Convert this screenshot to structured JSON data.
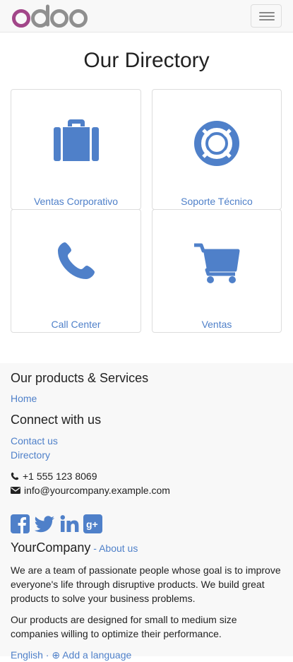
{
  "navbar": {
    "logo_text": "odoo",
    "menu_toggle_label": "Toggle navigation"
  },
  "page": {
    "title": "Our Directory"
  },
  "directory": [
    {
      "label": "Ventas Corporativo",
      "icon": "briefcase-icon"
    },
    {
      "label": "Soporte Técnico",
      "icon": "life-ring-icon"
    },
    {
      "label": "Call Center",
      "icon": "phone-icon"
    },
    {
      "label": "Ventas",
      "icon": "shopping-cart-icon"
    }
  ],
  "footer": {
    "products_heading": "Our products & Services",
    "home_link": "Home",
    "connect_heading": "Connect with us",
    "contact_link": "Contact us",
    "directory_link": "Directory",
    "phone": "+1 555 123 8069",
    "email": "info@yourcompany.example.com",
    "social": [
      "facebook-icon",
      "twitter-icon",
      "linkedin-icon",
      "google-plus-icon"
    ],
    "company_name": "YourCompany",
    "about_separator": " - ",
    "about_link": "About us",
    "about_p1": "We are a team of passionate people whose goal is to improve everyone's life through disruptive products. We build great products to solve your business problems.",
    "about_p2": "Our products are designed for small to medium size companies willing to optimize their performance.",
    "language_link": "English · ⊕ Add a language"
  },
  "colors": {
    "accent": "#4f80c9",
    "logo_purple": "#a24689",
    "logo_gray": "#8f8f8f",
    "navbar_bg": "#f8f8f8"
  }
}
